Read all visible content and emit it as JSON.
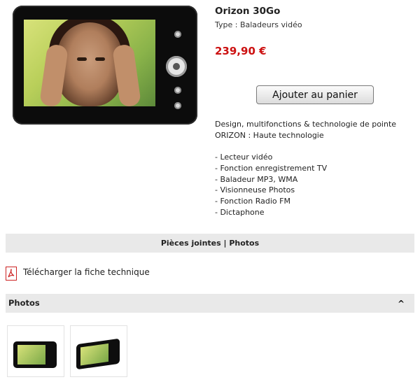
{
  "product": {
    "name": "Orizon 30Go",
    "type": "Type : Baladeurs vidéo",
    "price": "239,90 €",
    "add_to_cart": "Ajouter au panier",
    "description": [
      "Design, multifonctions & technologie de pointe",
      "ORIZON : Haute technologie"
    ],
    "features": [
      "- Lecteur vidéo",
      "- Fonction enregistrement TV",
      "- Baladeur MP3, WMA",
      "- Visionneuse Photos",
      "- Fonction Radio FM",
      "- Dictaphone"
    ]
  },
  "attachments_bar": {
    "label": "Pièces jointes | Photos"
  },
  "download": {
    "label": "Télécharger la fiche technique",
    "icon": "pdf-icon"
  },
  "photos_bar": {
    "label": "Photos",
    "toggle": "^"
  },
  "colors": {
    "price": "#cc1111",
    "bar": "#e9e9e9"
  }
}
